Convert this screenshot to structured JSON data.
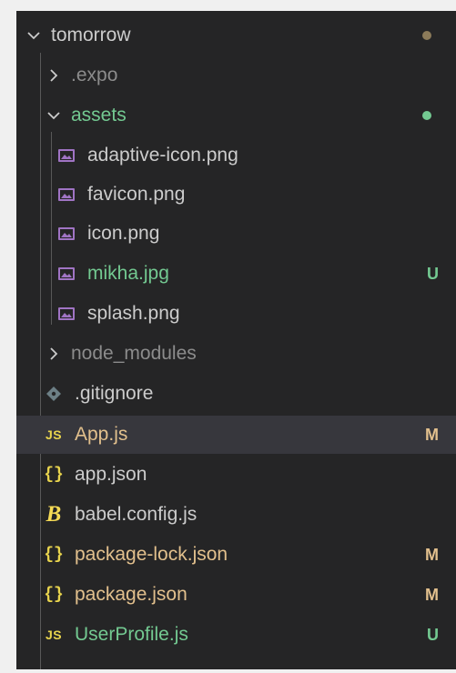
{
  "explorer": {
    "rows": [
      {
        "label": "tomorrow",
        "kind": "folder-open",
        "icon": "chevron-down-icon",
        "color": "#cccccc",
        "status_dot": "#8c7b5a"
      },
      {
        "label": ".expo",
        "kind": "folder-closed",
        "icon": "chevron-right-icon",
        "color": "#8c8c8c"
      },
      {
        "label": "assets",
        "kind": "folder-open",
        "icon": "chevron-down-icon",
        "color": "#73c991",
        "status_dot": "#73c991"
      },
      {
        "label": "adaptive-icon.png",
        "kind": "image",
        "icon": "image-file-icon",
        "color": "#cccccc"
      },
      {
        "label": "favicon.png",
        "kind": "image",
        "icon": "image-file-icon",
        "color": "#cccccc"
      },
      {
        "label": "icon.png",
        "kind": "image",
        "icon": "image-file-icon",
        "color": "#cccccc"
      },
      {
        "label": "mikha.jpg",
        "kind": "image",
        "icon": "image-file-icon",
        "color": "#73c991",
        "badge": "U"
      },
      {
        "label": "splash.png",
        "kind": "image",
        "icon": "image-file-icon",
        "color": "#cccccc"
      },
      {
        "label": "node_modules",
        "kind": "folder-closed",
        "icon": "chevron-right-icon",
        "color": "#8c8c8c"
      },
      {
        "label": ".gitignore",
        "kind": "file",
        "icon": "git-diamond-icon",
        "color": "#cccccc"
      },
      {
        "label": "App.js",
        "kind": "file",
        "icon": "javascript-icon",
        "icon_text": "JS",
        "color": "#e2c08d",
        "badge": "M",
        "selected": true
      },
      {
        "label": "app.json",
        "kind": "file",
        "icon": "json-icon",
        "icon_text": "{}",
        "color": "#cccccc"
      },
      {
        "label": "babel.config.js",
        "kind": "file",
        "icon": "babel-icon",
        "icon_text": "B",
        "color": "#cccccc"
      },
      {
        "label": "package-lock.json",
        "kind": "file",
        "icon": "json-icon",
        "icon_text": "{}",
        "color": "#e2c08d",
        "badge": "M"
      },
      {
        "label": "package.json",
        "kind": "file",
        "icon": "json-icon",
        "icon_text": "{}",
        "color": "#e2c08d",
        "badge": "M"
      },
      {
        "label": "UserProfile.js",
        "kind": "file",
        "icon": "javascript-icon",
        "icon_text": "JS",
        "color": "#73c991",
        "badge": "U"
      }
    ]
  }
}
